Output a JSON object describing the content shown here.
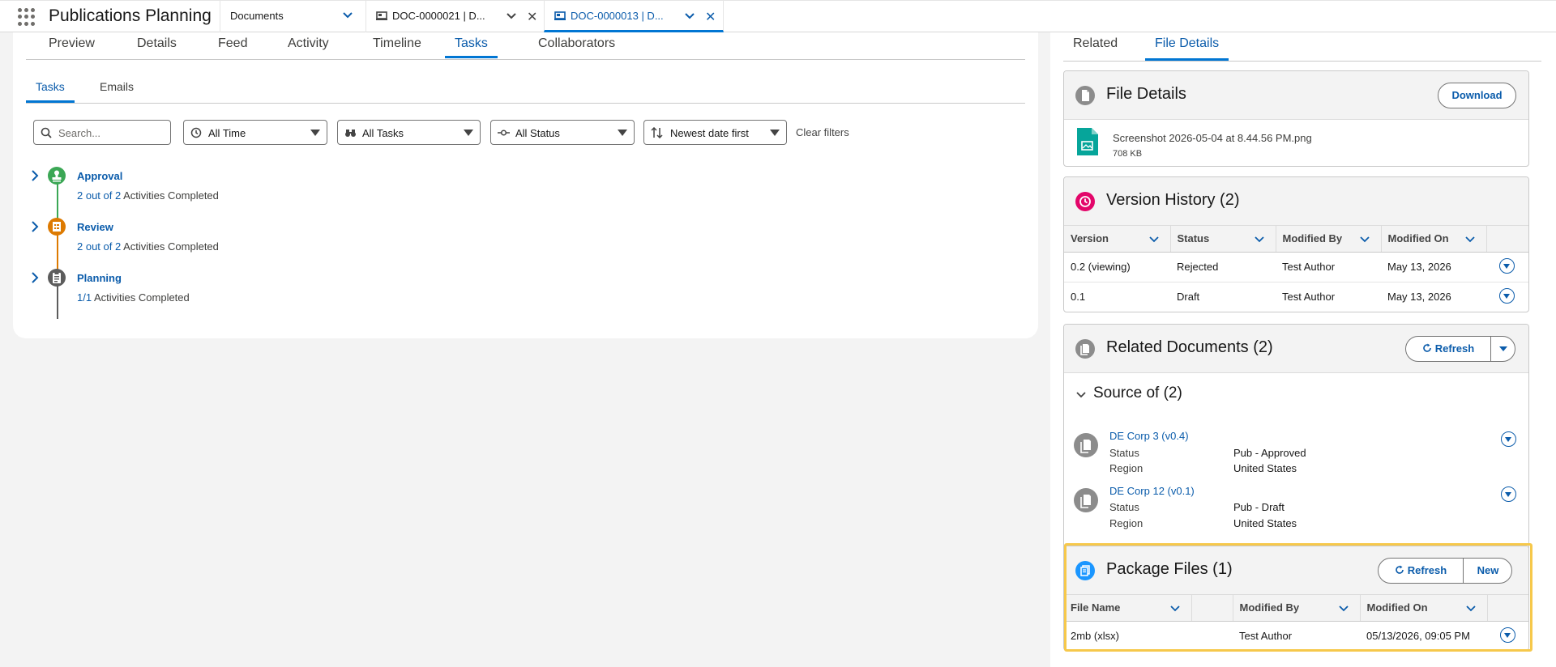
{
  "app": {
    "name": "Publications Planning",
    "nav_selected": "Documents"
  },
  "tabs": [
    {
      "label": "DOC-0000021 | D...",
      "active": false
    },
    {
      "label": "DOC-0000013 | D...",
      "active": true
    }
  ],
  "record_tabs": [
    "Preview",
    "Details",
    "Feed",
    "Activity",
    "Timeline",
    "Tasks",
    "Collaborators"
  ],
  "record_tabs_active": "Tasks",
  "sub_tabs": [
    "Tasks",
    "Emails"
  ],
  "sub_tabs_active": "Tasks",
  "filters": {
    "search_placeholder": "Search...",
    "time": "All Time",
    "tasks": "All Tasks",
    "status": "All Status",
    "sort": "Newest date first",
    "clear": "Clear filters"
  },
  "phases": [
    {
      "title": "Approval",
      "progress": "2 out of 2",
      "suffix": "Activities Completed",
      "color": "#3ba755",
      "icon": "stamp-icon"
    },
    {
      "title": "Review",
      "progress": "2 out of 2",
      "suffix": "Activities Completed",
      "color": "#dd7a01",
      "icon": "review-icon"
    },
    {
      "title": "Planning",
      "progress": "1/1",
      "suffix": "Activities Completed",
      "color": "#5c5c5c",
      "icon": "clipboard-icon"
    }
  ],
  "right_tabs": [
    "Related",
    "File Details"
  ],
  "right_tabs_active": "File Details",
  "file_details": {
    "title": "File Details",
    "download": "Download",
    "file_name": "Screenshot 2026-05-04 at 8.44.56 PM.png",
    "file_size": "708 KB"
  },
  "version_history": {
    "title": "Version History (2)",
    "columns": [
      "Version",
      "Status",
      "Modified By",
      "Modified On"
    ],
    "rows": [
      {
        "version": "0.2 (viewing)",
        "status": "Rejected",
        "modified_by": "Test Author",
        "modified_on": "May 13, 2026"
      },
      {
        "version": "0.1",
        "status": "Draft",
        "modified_by": "Test Author",
        "modified_on": "May 13, 2026"
      }
    ]
  },
  "related_documents": {
    "title": "Related Documents (2)",
    "refresh": "Refresh",
    "section": "Source of (2)",
    "items": [
      {
        "name": "DE Corp 3 (v0.4)",
        "status_label": "Status",
        "status": "Pub - Approved",
        "region_label": "Region",
        "region": "United States"
      },
      {
        "name": "DE Corp 12 (v0.1)",
        "status_label": "Status",
        "status": "Pub - Draft",
        "region_label": "Region",
        "region": "United States"
      }
    ]
  },
  "package_files": {
    "title": "Package Files (1)",
    "refresh": "Refresh",
    "new": "New",
    "columns": [
      "File Name",
      "Modified By",
      "Modified On"
    ],
    "rows": [
      {
        "file_name": "2mb (xlsx)",
        "modified_by": "Test Author",
        "modified_on": "05/13/2026, 09:05 PM"
      }
    ]
  },
  "colors": {
    "accent": "#0176d3",
    "link": "#0b5cab",
    "highlight": "#f6c84b"
  }
}
